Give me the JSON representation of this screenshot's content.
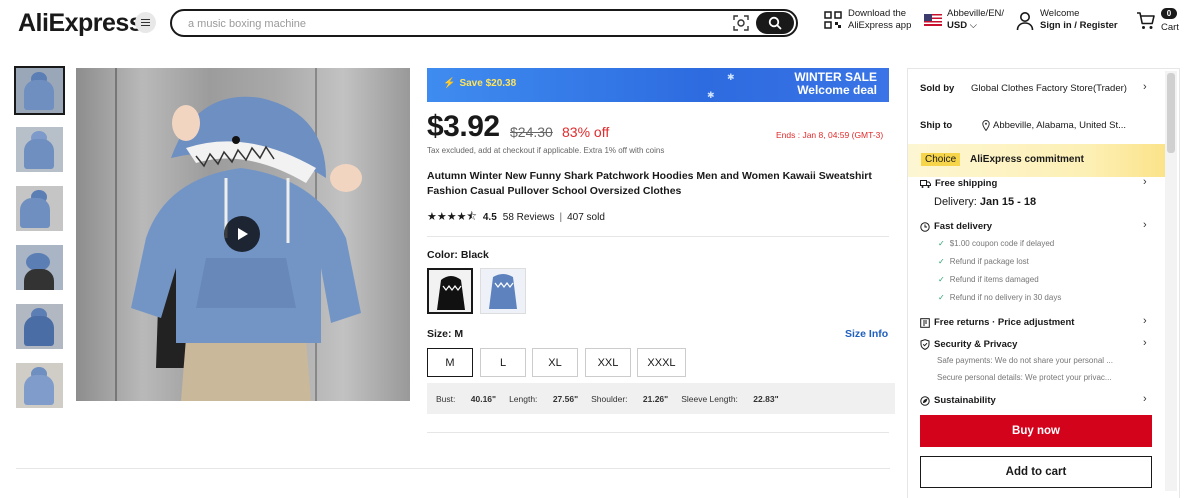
{
  "header": {
    "logo": "AliExpress",
    "search_placeholder": "a music boxing machine",
    "download_line1": "Download the",
    "download_line2": "AliExpress app",
    "locale_line1": "Abbeville/EN/",
    "locale_line2": "USD",
    "welcome_line1": "Welcome",
    "welcome_line2": "Sign in / Register",
    "cart_count": "0",
    "cart_label": "Cart"
  },
  "gallery": {
    "thumbnail_count": 6,
    "active_index": 0
  },
  "banner": {
    "save": "Save $20.38",
    "title": "WINTER SALE",
    "subtitle": "Welcome deal"
  },
  "price": {
    "current": "$3.92",
    "original": "$24.30",
    "discount": "83% off",
    "ends": "Ends : Jan 8, 04:59 (GMT-3)",
    "tax_note": "Tax excluded, add at checkout if applicable. Extra 1% off with coins"
  },
  "product": {
    "title": "Autumn Winter New Funny Shark Patchwork Hoodies Men and Women Kawaii Sweatshirt Fashion Casual Pullover School Oversized Clothes",
    "rating": 4.5,
    "rating_text": "4.5",
    "reviews": "58 Reviews",
    "sold": "407 sold"
  },
  "color": {
    "label": "Color: Black"
  },
  "size": {
    "label": "Size: M",
    "info": "Size Info",
    "options": [
      "M",
      "L",
      "XL",
      "XXL",
      "XXXL"
    ],
    "selected": "M",
    "measurements": {
      "bust_label": "Bust:",
      "bust": "40.16\"",
      "length_label": "Length:",
      "length": "27.56\"",
      "shoulder_label": "Shoulder:",
      "shoulder": "21.26\"",
      "sleeve_label": "Sleeve Length:",
      "sleeve": "22.83\""
    }
  },
  "panel": {
    "sold_by_label": "Sold by",
    "sold_by": "Global Clothes Factory Store(Trader)",
    "ship_to_label": "Ship to",
    "ship_to": "Abbeville, Alabama, United St...",
    "choice_tag": "Choice",
    "commitment": "AliExpress commitment",
    "free_shipping": "Free shipping",
    "delivery_label": "Delivery:",
    "delivery_dates": "Jan 15 - 18",
    "fast_delivery": "Fast delivery",
    "fast_items": [
      "$1.00 coupon code if delayed",
      "Refund if package lost",
      "Refund if items damaged",
      "Refund if no delivery in 30 days"
    ],
    "free_returns": "Free returns · Price adjustment",
    "security": "Security & Privacy",
    "security_items": [
      "Safe payments: We do not share your personal ...",
      "Secure personal details: We protect your privac..."
    ],
    "sustainability": "Sustainability",
    "buy_now": "Buy now",
    "add_to_cart": "Add to cart"
  },
  "colors": {
    "accent_red": "#d3031c",
    "price_red": "#e12b2b",
    "link_blue": "#1f5fbd",
    "banner_blue": "#2d6be0",
    "choice_yellow": "#f7d54a"
  }
}
